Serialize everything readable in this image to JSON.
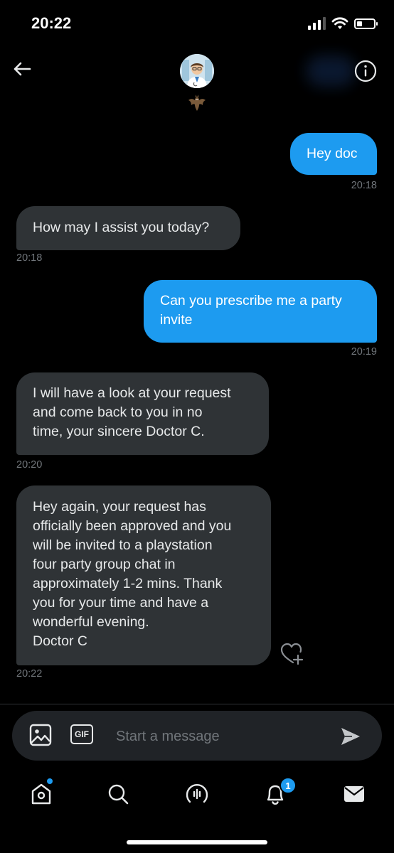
{
  "status_bar": {
    "time": "20:22"
  },
  "messages": [
    {
      "direction": "out",
      "lines": [
        "Hey doc"
      ],
      "time": "20:18"
    },
    {
      "direction": "in",
      "lines": [
        "How may I assist you today?"
      ],
      "time": "20:18"
    },
    {
      "direction": "out",
      "lines": [
        "Can you prescribe me a party",
        "invite"
      ],
      "time": "20:19"
    },
    {
      "direction": "in",
      "lines": [
        "I will have a look at your request",
        "and come back to you in no",
        "time, your sincere Doctor C."
      ],
      "time": "20:20"
    },
    {
      "direction": "in",
      "lines": [
        "Hey again, your request has",
        "officially been approved and you",
        "will be invited to a playstation",
        "four party group chat in",
        "approximately 1-2 mins. Thank",
        "you for your time and have a",
        "wonderful evening.",
        "Doctor C"
      ],
      "time": "20:22"
    }
  ],
  "composer": {
    "placeholder": "Start a message",
    "gif_label": "GIF"
  },
  "nav": {
    "notifications_count": "1"
  },
  "icons": {
    "back": "arrow-left-icon",
    "info": "info-icon",
    "media": "image-icon",
    "gif": "gif-icon",
    "send": "send-icon",
    "home": "home-icon",
    "search": "search-icon",
    "spaces": "spaces-icon",
    "notifications": "bell-icon",
    "messages": "mail-icon",
    "react": "heart-plus-icon"
  },
  "colors": {
    "accent": "#1d9bf0",
    "incoming_bubble": "#2f3336",
    "muted_text": "#71767b",
    "background": "#000000"
  }
}
